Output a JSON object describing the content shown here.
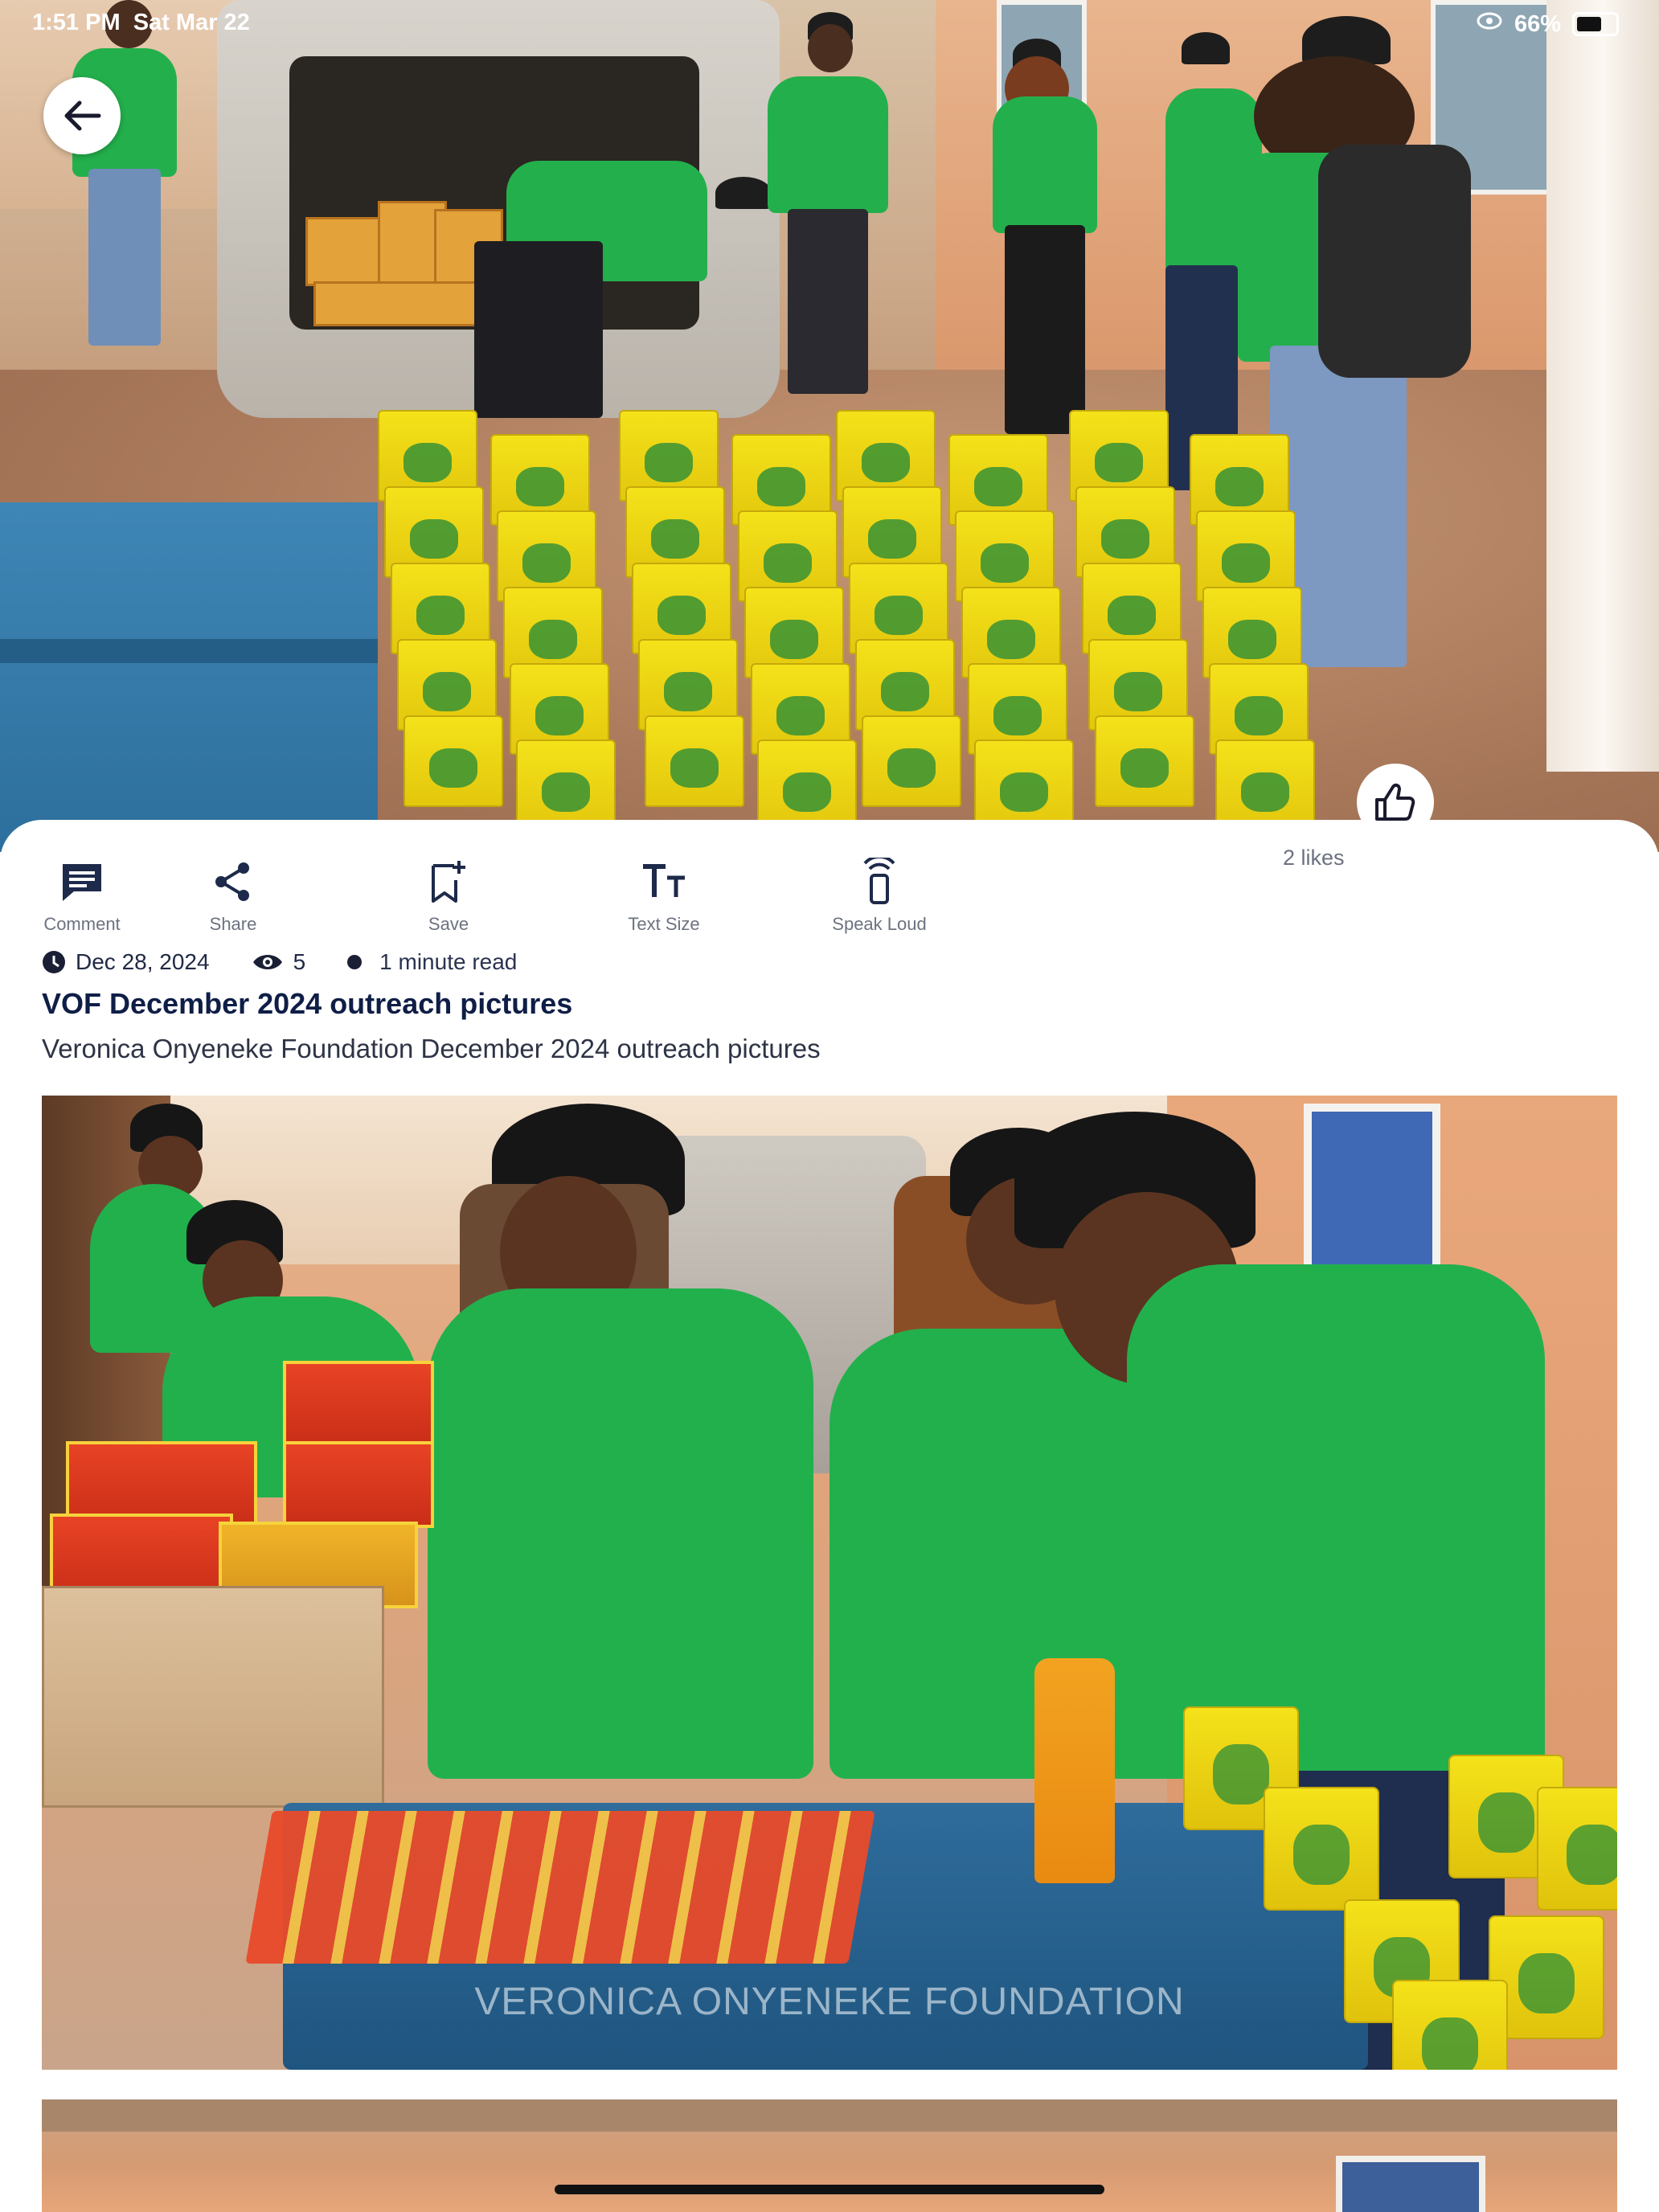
{
  "status_bar": {
    "time": "1:51 PM",
    "date": "Sat Mar 22",
    "battery": "66%"
  },
  "nav": {
    "back_icon": "arrow-left-icon"
  },
  "article": {
    "likes": "2 likes",
    "actions": [
      {
        "label": "Comment",
        "icon": "comment-icon"
      },
      {
        "label": "Share",
        "icon": "share-icon"
      },
      {
        "label": "Save",
        "icon": "bookmark-add-icon"
      },
      {
        "label": "Text Size",
        "icon": "text-size-icon"
      },
      {
        "label": "Speak Loud",
        "icon": "speaker-icon"
      }
    ],
    "date": "Dec 28, 2024",
    "views": "5",
    "read_time": "1 minute read",
    "title": "VOF December 2024 outreach pictures",
    "subtitle": "Veronica Onyeneke Foundation December 2024 outreach pictures",
    "watermark": "VERONICA ONYENEKE FOUNDATION"
  },
  "colors": {
    "title": "#0f1e46",
    "muted": "#6c7280",
    "shirt_green": "#23b04c",
    "bag_yellow": "#f4e21a"
  }
}
